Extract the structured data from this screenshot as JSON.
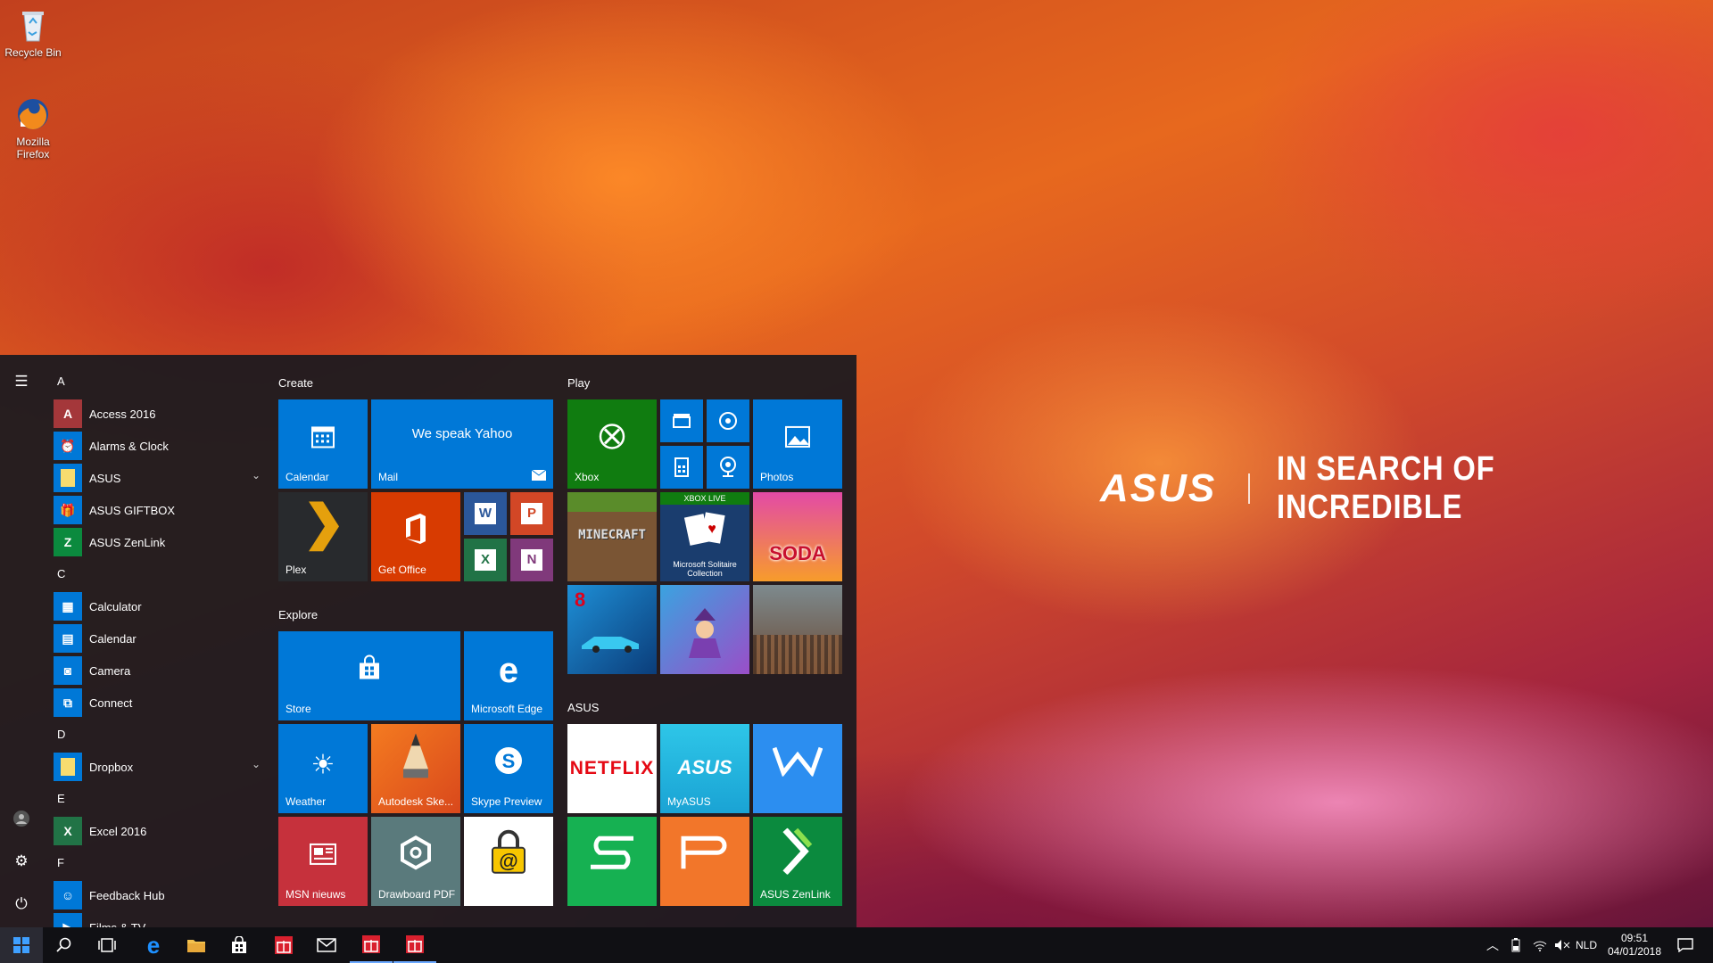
{
  "desktop": {
    "icons": [
      {
        "label": "Recycle Bin",
        "icon": "recycle-bin-icon"
      },
      {
        "label": "Mozilla Firefox",
        "icon": "firefox-icon"
      }
    ],
    "brand": {
      "logo": "ASUS",
      "slogan": "IN SEARCH OF INCREDIBLE"
    }
  },
  "start_menu": {
    "app_list": [
      {
        "type": "letter",
        "label": "A"
      },
      {
        "type": "app",
        "label": "Access 2016",
        "color": "#a4373a",
        "glyph": "A"
      },
      {
        "type": "app",
        "label": "Alarms & Clock",
        "color": "#0078d7",
        "glyph": "⏰"
      },
      {
        "type": "app",
        "label": "ASUS",
        "color": "#0078d7",
        "glyph": "",
        "folder": true
      },
      {
        "type": "app",
        "label": "ASUS GIFTBOX",
        "color": "#0078d7",
        "glyph": "🎁"
      },
      {
        "type": "app",
        "label": "ASUS ZenLink",
        "color": "#0b8a3e",
        "glyph": "Z"
      },
      {
        "type": "letter",
        "label": "C"
      },
      {
        "type": "app",
        "label": "Calculator",
        "color": "#0078d7",
        "glyph": "▦"
      },
      {
        "type": "app",
        "label": "Calendar",
        "color": "#0078d7",
        "glyph": "▤"
      },
      {
        "type": "app",
        "label": "Camera",
        "color": "#0078d7",
        "glyph": "◙"
      },
      {
        "type": "app",
        "label": "Connect",
        "color": "#0078d7",
        "glyph": "⧉"
      },
      {
        "type": "letter",
        "label": "D"
      },
      {
        "type": "app",
        "label": "Dropbox",
        "color": "#0078d7",
        "glyph": "",
        "folder": true
      },
      {
        "type": "letter",
        "label": "E"
      },
      {
        "type": "app",
        "label": "Excel 2016",
        "color": "#217346",
        "glyph": "X"
      },
      {
        "type": "letter",
        "label": "F"
      },
      {
        "type": "app",
        "label": "Feedback Hub",
        "color": "#0078d7",
        "glyph": "☺"
      },
      {
        "type": "app",
        "label": "Films & TV",
        "color": "#0078d7",
        "glyph": "▶"
      }
    ],
    "groups": {
      "create": "Create",
      "play": "Play",
      "explore": "Explore",
      "asus": "ASUS"
    },
    "tiles": {
      "calendar": "Calendar",
      "mail": "Mail",
      "mail_message": "We speak Yahoo",
      "plex": "Plex",
      "get_office": "Get Office",
      "xbox": "Xbox",
      "photos": "Photos",
      "minecraft": "MINECRAFT",
      "solitaire_badge": "XBOX LIVE",
      "solitaire": "Microsoft Solitaire Collection",
      "candy": "SODA",
      "store": "Store",
      "edge": "Microsoft Edge",
      "weather": "Weather",
      "autodesk": "Autodesk Ske...",
      "skype": "Skype Preview",
      "msn": "MSN nieuws",
      "drawboard": "Drawboard PDF",
      "netflix": "NETFLIX",
      "myasus": "MyASUS",
      "myasus_logo": "ASUS",
      "zenlink": "ASUS ZenLink"
    },
    "colors": {
      "tile_blue": "#0078d7",
      "office_orange": "#d83b01",
      "xbox_green": "#107c10",
      "netflix_red": "#e50914"
    }
  },
  "taskbar": {
    "language": "NLD",
    "time": "09:51",
    "date": "04/01/2018"
  }
}
